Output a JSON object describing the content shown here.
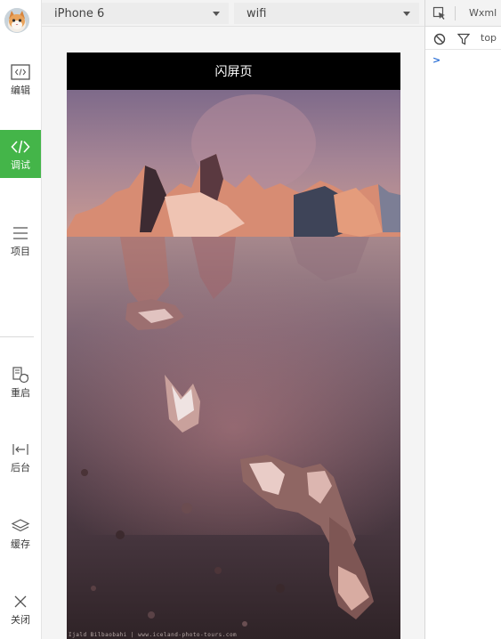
{
  "sidebar": {
    "items": [
      {
        "label": "编辑",
        "icon": "code-box-icon"
      },
      {
        "label": "调试",
        "icon": "code-brackets-icon"
      },
      {
        "label": "项目",
        "icon": "menu-icon"
      },
      {
        "label": "重启",
        "icon": "restart-icon"
      },
      {
        "label": "后台",
        "icon": "background-icon"
      },
      {
        "label": "缓存",
        "icon": "layers-icon"
      },
      {
        "label": "关闭",
        "icon": "close-icon"
      }
    ],
    "active_color": "#44b549"
  },
  "toolbar": {
    "device": "iPhone 6",
    "network": "wifi"
  },
  "simulator": {
    "page_title": "闪屏页",
    "photo_credit": "Ijald Bilbaobahi | www.iceland-photo-tours.com"
  },
  "devtools": {
    "tab_label": "Wxml",
    "context": "top",
    "prompt": ">"
  }
}
